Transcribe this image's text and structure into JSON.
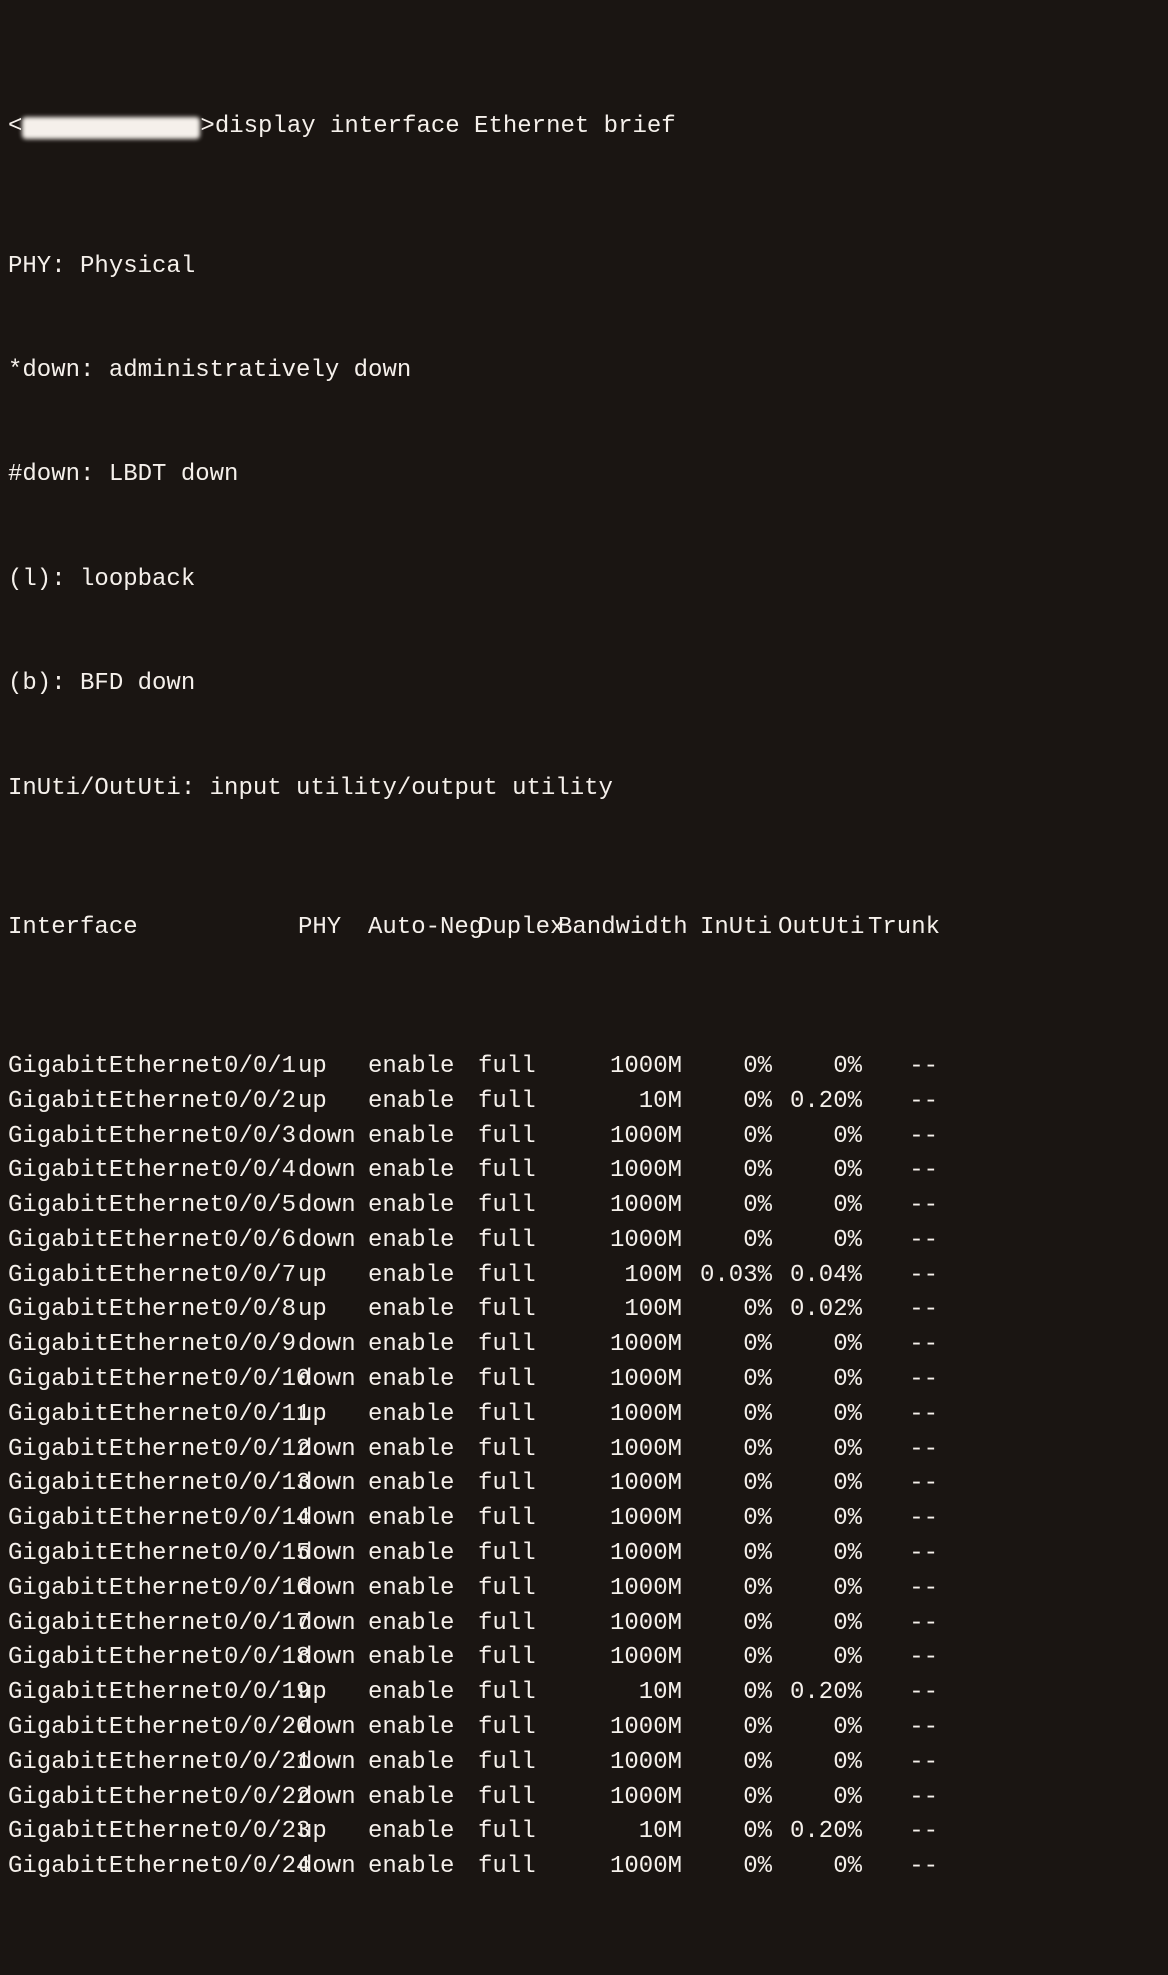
{
  "prompt": {
    "prefix": "<",
    "suffix": ">",
    "command": "display interface Ethernet brief"
  },
  "legend": {
    "l1": "PHY: Physical",
    "l2": "*down: administratively down",
    "l3": "#down: LBDT down",
    "l4": "(l): loopback",
    "l5": "(b): BFD down",
    "l6": "InUti/OutUti: input utility/output utility"
  },
  "headers": {
    "iface": "Interface",
    "phy": "PHY",
    "auto": "Auto-Neg",
    "duplex": "Duplex",
    "bw": "Bandwidth",
    "inuti": "InUti",
    "oututi": "OutUti",
    "trunk": "Trunk"
  },
  "rows": [
    {
      "iface": "GigabitEthernet0/0/1",
      "phy": "up",
      "auto": "enable",
      "dup": "full",
      "bw": "1000M",
      "in": "0%",
      "out": "0%",
      "trk": "--"
    },
    {
      "iface": "GigabitEthernet0/0/2",
      "phy": "up",
      "auto": "enable",
      "dup": "full",
      "bw": "10M",
      "in": "0%",
      "out": "0.20%",
      "trk": "--"
    },
    {
      "iface": "GigabitEthernet0/0/3",
      "phy": "down",
      "auto": "enable",
      "dup": "full",
      "bw": "1000M",
      "in": "0%",
      "out": "0%",
      "trk": "--"
    },
    {
      "iface": "GigabitEthernet0/0/4",
      "phy": "down",
      "auto": "enable",
      "dup": "full",
      "bw": "1000M",
      "in": "0%",
      "out": "0%",
      "trk": "--"
    },
    {
      "iface": "GigabitEthernet0/0/5",
      "phy": "down",
      "auto": "enable",
      "dup": "full",
      "bw": "1000M",
      "in": "0%",
      "out": "0%",
      "trk": "--"
    },
    {
      "iface": "GigabitEthernet0/0/6",
      "phy": "down",
      "auto": "enable",
      "dup": "full",
      "bw": "1000M",
      "in": "0%",
      "out": "0%",
      "trk": "--"
    },
    {
      "iface": "GigabitEthernet0/0/7",
      "phy": "up",
      "auto": "enable",
      "dup": "full",
      "bw": "100M",
      "in": "0.03%",
      "out": "0.04%",
      "trk": "--"
    },
    {
      "iface": "GigabitEthernet0/0/8",
      "phy": "up",
      "auto": "enable",
      "dup": "full",
      "bw": "100M",
      "in": "0%",
      "out": "0.02%",
      "trk": "--"
    },
    {
      "iface": "GigabitEthernet0/0/9",
      "phy": "down",
      "auto": "enable",
      "dup": "full",
      "bw": "1000M",
      "in": "0%",
      "out": "0%",
      "trk": "--"
    },
    {
      "iface": "GigabitEthernet0/0/10",
      "phy": "down",
      "auto": "enable",
      "dup": "full",
      "bw": "1000M",
      "in": "0%",
      "out": "0%",
      "trk": "--"
    },
    {
      "iface": "GigabitEthernet0/0/11",
      "phy": "up",
      "auto": "enable",
      "dup": "full",
      "bw": "1000M",
      "in": "0%",
      "out": "0%",
      "trk": "--"
    },
    {
      "iface": "GigabitEthernet0/0/12",
      "phy": "down",
      "auto": "enable",
      "dup": "full",
      "bw": "1000M",
      "in": "0%",
      "out": "0%",
      "trk": "--"
    },
    {
      "iface": "GigabitEthernet0/0/13",
      "phy": "down",
      "auto": "enable",
      "dup": "full",
      "bw": "1000M",
      "in": "0%",
      "out": "0%",
      "trk": "--"
    },
    {
      "iface": "GigabitEthernet0/0/14",
      "phy": "down",
      "auto": "enable",
      "dup": "full",
      "bw": "1000M",
      "in": "0%",
      "out": "0%",
      "trk": "--"
    },
    {
      "iface": "GigabitEthernet0/0/15",
      "phy": "down",
      "auto": "enable",
      "dup": "full",
      "bw": "1000M",
      "in": "0%",
      "out": "0%",
      "trk": "--"
    },
    {
      "iface": "GigabitEthernet0/0/16",
      "phy": "down",
      "auto": "enable",
      "dup": "full",
      "bw": "1000M",
      "in": "0%",
      "out": "0%",
      "trk": "--"
    },
    {
      "iface": "GigabitEthernet0/0/17",
      "phy": "down",
      "auto": "enable",
      "dup": "full",
      "bw": "1000M",
      "in": "0%",
      "out": "0%",
      "trk": "--"
    },
    {
      "iface": "GigabitEthernet0/0/18",
      "phy": "down",
      "auto": "enable",
      "dup": "full",
      "bw": "1000M",
      "in": "0%",
      "out": "0%",
      "trk": "--"
    },
    {
      "iface": "GigabitEthernet0/0/19",
      "phy": "up",
      "auto": "enable",
      "dup": "full",
      "bw": "10M",
      "in": "0%",
      "out": "0.20%",
      "trk": "--"
    },
    {
      "iface": "GigabitEthernet0/0/20",
      "phy": "down",
      "auto": "enable",
      "dup": "full",
      "bw": "1000M",
      "in": "0%",
      "out": "0%",
      "trk": "--"
    },
    {
      "iface": "GigabitEthernet0/0/21",
      "phy": "down",
      "auto": "enable",
      "dup": "full",
      "bw": "1000M",
      "in": "0%",
      "out": "0%",
      "trk": "--"
    },
    {
      "iface": "GigabitEthernet0/0/22",
      "phy": "down",
      "auto": "enable",
      "dup": "full",
      "bw": "1000M",
      "in": "0%",
      "out": "0%",
      "trk": "--"
    },
    {
      "iface": "GigabitEthernet0/0/23",
      "phy": "up",
      "auto": "enable",
      "dup": "full",
      "bw": "10M",
      "in": "0%",
      "out": "0.20%",
      "trk": "--"
    },
    {
      "iface": "GigabitEthernet0/0/24",
      "phy": "down",
      "auto": "enable",
      "dup": "full",
      "bw": "1000M",
      "in": "0%",
      "out": "0%",
      "trk": "--"
    }
  ]
}
